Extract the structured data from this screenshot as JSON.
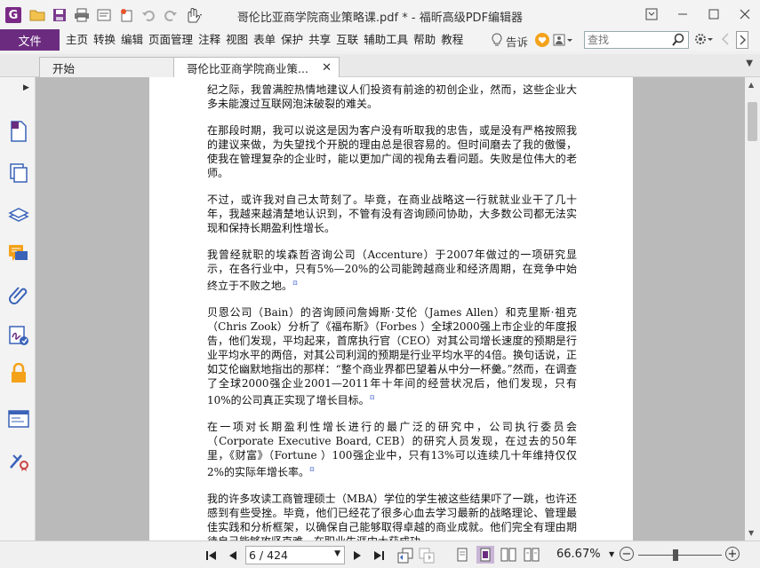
{
  "app": {
    "window_title": "哥伦比亚商学院商业策略课.pdf * - 福昕高级PDF编辑器",
    "logo_letter": "G"
  },
  "menu": {
    "file": "文件",
    "items": [
      "主页",
      "转换",
      "编辑",
      "页面管理",
      "注释",
      "视图",
      "表单",
      "保护",
      "共享",
      "互联",
      "辅助工具",
      "帮助",
      "教程"
    ],
    "tell_me": "告诉"
  },
  "search": {
    "placeholder": "查找"
  },
  "tabs": [
    {
      "label": "开始"
    },
    {
      "label": "哥伦比亚商学院商业策..."
    }
  ],
  "document": {
    "paragraphs": [
      "纪之际，我曾满腔热情地建议人们投资有前途的初创企业，然而，这些企业大多未能渡过互联网泡沫破裂的难关。",
      "在那段时期，我可以说这是因为客户没有听取我的忠告，或是没有严格按照我的建议来做，为失望找个开脱的理由总是很容易的。但时间磨去了我的傲慢，使我在管理复杂的企业时，能以更加广阔的视角去看问题。失败是位伟大的老师。",
      "不过，或许我对自己太苛刻了。毕竟，在商业战略这一行就就业业干了几十年，我越来越清楚地认识到，不管有没有咨询顾问协助，大多数公司都无法实现和保持长期盈利性增长。",
      "我曾经就职的埃森哲咨询公司（Accenture）于2007年做过的一项研究显示，在各行业中，只有5%—20%的公司能跨越商业和经济周期，在竞争中始终立于不败之地。",
      "贝恩公司（Bain）的咨询顾问詹姆斯·艾伦（James  Allen）和克里斯·祖克（Chris Zook）分析了《福布斯》（Forbes ）全球2000强上市企业的年度报告，他们发现，平均起来，首席执行官（CEO）对其公司增长速度的预期是行业平均水平的两倍，对其公司利润的预期是行业平均水平的4倍。换句话说，正如艾伦幽默地指出的那样：“整个商业界都巴望着从中分一杯羹。”然而，在调查了全球2000强企业2001—2011年十年间的经营状况后，他们发现，只有10%的公司真正实现了增长目标。",
      "在一项对长期盈利性增长进行的最广泛的研究中，公司执行委员会（Corporate Executive Board, CEB）的研究人员发现，在过去的50年里，《财富》（Fortune ）100强企业中，只有13%可以连续几十年维持仅仅2%的实际年增长率。",
      "我的许多攻读工商管理硕士（MBA）学位的学生被这些结果吓了一跳，也许还感到有些受挫。毕竟，他们已经花了很多心血去学习最新的战略理论、管理最佳实践和分析框架，以确保自己能够取得卓越的商业成就。他们完全有理由期待自己能够攻坚克难，在职业生涯中大获成功。"
    ],
    "note_marker": "⊡"
  },
  "status": {
    "page_display": "6 / 424",
    "zoom_label": "66.67%"
  },
  "colors": {
    "brand": "#6b2c80",
    "doc_background": "#bababa",
    "active_view_mode": "#c9b6d6"
  }
}
